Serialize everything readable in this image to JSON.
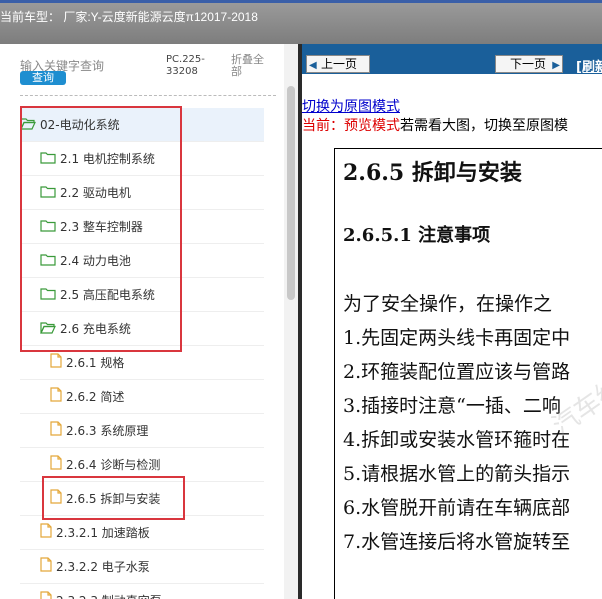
{
  "header": {
    "title": "当前车型： 厂家:Y-云度新能源云度π12017-2018"
  },
  "search": {
    "placeholder": "输入关键字查询",
    "button": "查询",
    "code": "PC.225-33208",
    "collapse_all": "折叠全部"
  },
  "tree": [
    {
      "label": "02-电动化系统",
      "type": "folder",
      "level": 1
    },
    {
      "label": "2.1 电机控制系统",
      "type": "folder",
      "level": 2
    },
    {
      "label": "2.2 驱动电机",
      "type": "folder",
      "level": 2
    },
    {
      "label": "2.3 整车控制器",
      "type": "folder",
      "level": 2
    },
    {
      "label": "2.4 动力电池",
      "type": "folder",
      "level": 2
    },
    {
      "label": "2.5 高压配电系统",
      "type": "folder",
      "level": 2
    },
    {
      "label": "2.6 充电系统",
      "type": "folder",
      "level": 2
    },
    {
      "label": "2.6.1 规格",
      "type": "file",
      "level": 3
    },
    {
      "label": "2.6.2 简述",
      "type": "file",
      "level": 3
    },
    {
      "label": "2.6.3 系统原理",
      "type": "file",
      "level": 3
    },
    {
      "label": "2.6.4 诊断与检测",
      "type": "file",
      "level": 3
    },
    {
      "label": "2.6.5 拆卸与安装",
      "type": "file",
      "level": 3
    },
    {
      "label": "2.3.2.1 加速踏板",
      "type": "file",
      "level": 2
    },
    {
      "label": "2.3.2.2 电子水泵",
      "type": "file",
      "level": 2
    },
    {
      "label": "2.3.2.3 制动真空泵",
      "type": "file",
      "level": 2
    }
  ],
  "nav": {
    "prev": "上一页",
    "next": "下一页",
    "refresh": "[刷新"
  },
  "mode_link": "切换为原图模式",
  "notice": {
    "prefix": "当前：预览模式",
    "rest": "若需看大图，切换至原图模"
  },
  "document": {
    "heading": "2.6.5 拆卸与安装",
    "subheading": "2.6.5.1 注意事项",
    "paragraphs": [
      "为了安全操作，在操作之",
      "1.先固定两头线卡再固定中",
      "2.环箍装配位置应该与管路",
      "3.插接时注意“一插、二响",
      "4.拆卸或安装水管环箍时在",
      "5.请根据水管上的箭头指示",
      "6.水管脱开前请在车辆底部",
      "7.水管连接后将水管旋转至"
    ]
  },
  "watermark": "汽车维修",
  "colors": {
    "highlight": "#d9363e",
    "nav_bg": "#1a5f9a",
    "search_button": "#1e8ed0",
    "notice_red": "#dd0000"
  }
}
